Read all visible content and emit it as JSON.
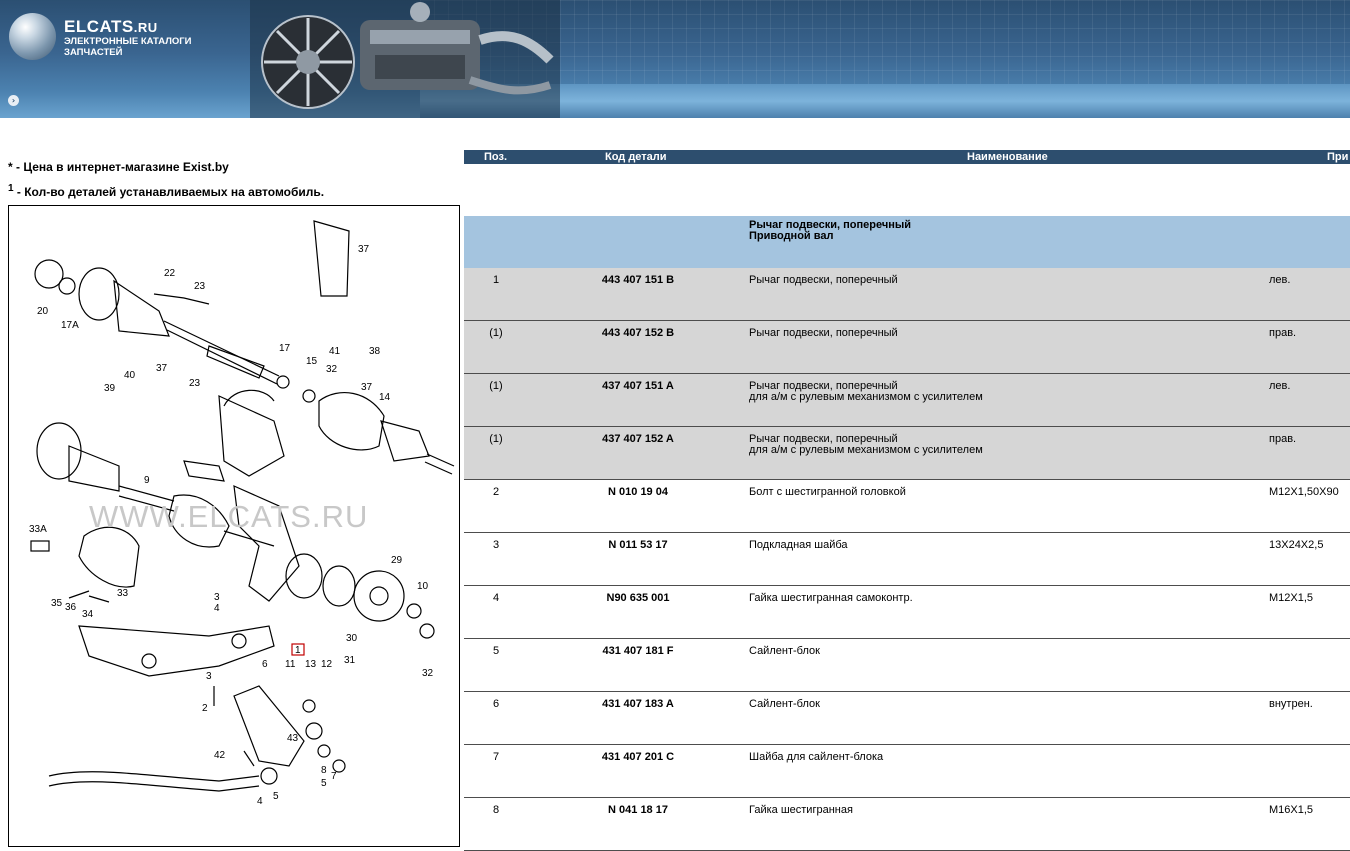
{
  "header": {
    "logo_title": "ELCATS",
    "logo_suffix": ".RU",
    "logo_subtitle": "ЭЛЕКТРОННЫЕ КАТАЛОГИ ЗАПЧАСТЕЙ",
    "nav_icon": "arrow-right-circle-icon"
  },
  "notes": {
    "price_mark": "*",
    "price_text": " - Цена в интернет-магазине Exist.by",
    "qty_mark": "1",
    "qty_text": " - Кол-во деталей устанавливаемых на автомобиль."
  },
  "diagram": {
    "watermark": "WWW.ELCATS.RU",
    "highlighted_label": "1",
    "labels": [
      "37",
      "22",
      "23",
      "20",
      "17A",
      "40",
      "37",
      "23",
      "39",
      "17",
      "15",
      "41",
      "32",
      "38",
      "37",
      "14",
      "9",
      "33A",
      "33",
      "35",
      "36",
      "34",
      "3",
      "4",
      "29",
      "10",
      "30",
      "31",
      "32",
      "6",
      "11",
      "13",
      "12",
      "3",
      "2",
      "43",
      "42",
      "8",
      "7",
      "5",
      "4",
      "5"
    ]
  },
  "table": {
    "columns": [
      "Поз.",
      "Код детали",
      "Наименование",
      "При"
    ],
    "group": {
      "line1": "Рычаг подвески, поперечный",
      "line2": "Приводной вал"
    },
    "rows": [
      {
        "pos": "1",
        "code": "443 407 151 B",
        "name": "Рычаг подвески, поперечный",
        "name2": "",
        "note": "лев.",
        "bg": "grey"
      },
      {
        "pos": "(1)",
        "code": "443 407 152 B",
        "name": "Рычаг подвески, поперечный",
        "name2": "",
        "note": "прав.",
        "bg": "grey"
      },
      {
        "pos": "(1)",
        "code": "437 407 151 A",
        "name": "Рычаг подвески, поперечный",
        "name2": "для а/м с рулевым механизмом с усилителем",
        "note": "лев.",
        "bg": "grey"
      },
      {
        "pos": "(1)",
        "code": "437 407 152 A",
        "name": "Рычаг подвески, поперечный",
        "name2": "для а/м с рулевым механизмом с усилителем",
        "note": "прав.",
        "bg": "grey"
      },
      {
        "pos": "2",
        "code": "N 010 19 04",
        "name": "Болт с шестигранной головкой",
        "name2": "",
        "note": "M12X1,50X90",
        "bg": "white"
      },
      {
        "pos": "3",
        "code": "N 011 53 17",
        "name": "Подкладная шайба",
        "name2": "",
        "note": "13X24X2,5",
        "bg": "white"
      },
      {
        "pos": "4",
        "code": "N90 635 001",
        "name": "Гайка шестигранная самоконтр.",
        "name2": "",
        "note": "M12X1,5",
        "bg": "white"
      },
      {
        "pos": "5",
        "code": "431 407 181 F",
        "name": "Сайлент-блок",
        "name2": "",
        "note": "",
        "bg": "white"
      },
      {
        "pos": "6",
        "code": "431 407 183 A",
        "name": "Сайлент-блок",
        "name2": "",
        "note": "внутрен.",
        "bg": "white"
      },
      {
        "pos": "7",
        "code": "431 407 201 C",
        "name": "Шайба для сайлент-блока",
        "name2": "",
        "note": "",
        "bg": "white"
      },
      {
        "pos": "8",
        "code": "N 041 18 17",
        "name": "Гайка шестигранная",
        "name2": "",
        "note": "M16X1,5",
        "bg": "white"
      }
    ]
  }
}
